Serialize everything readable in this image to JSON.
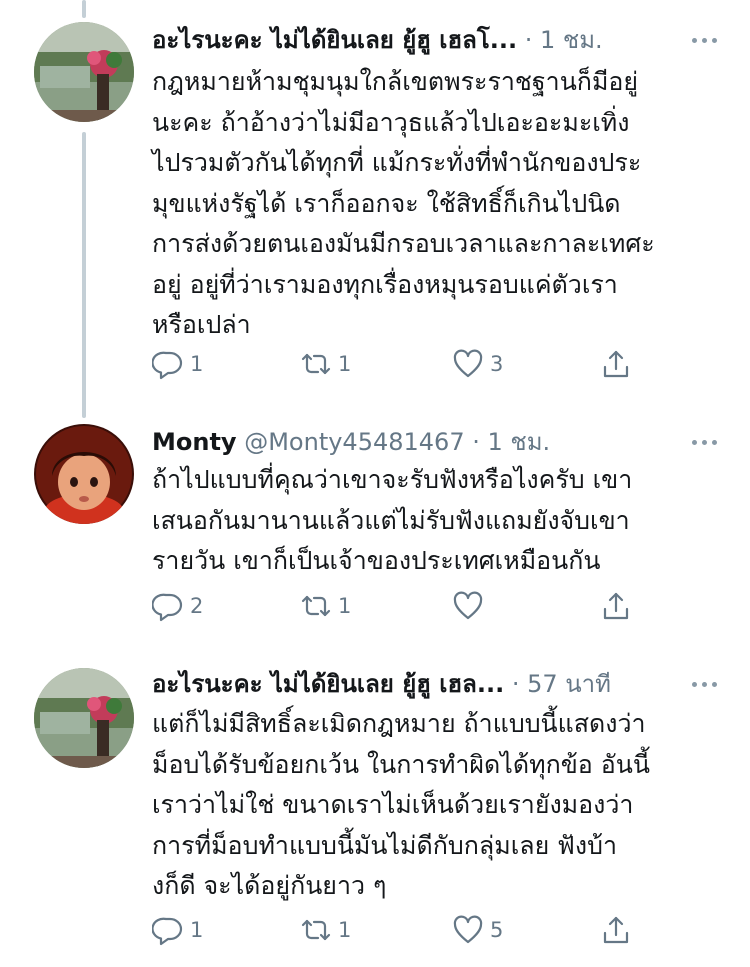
{
  "tweets": [
    {
      "name": "อะไรนะคะ ไม่ได้ยินเลย ยู้ฮู เฮลโ...",
      "handle": "",
      "dot": "·",
      "time": "1 ชม.",
      "lines": [
        "กฎหมายห้ามชุมนุมใกล้เขตพระราชฐานก็มีอยู่",
        "นะคะ ถ้าอ้างว่าไม่มีอาวุธแล้วไปเอะอะมะเทิ่ง",
        "ไปรวมตัวกันได้ทุกที่ แม้กระทั่งที่พำนักของประ",
        "มุขแห่งรัฐได้ เราก็ออกจะ ใช้สิทธิ์ก็เกินไปนิด",
        "การส่งด้วยตนเองมันมีกรอบเวลาและกาละเทศะ",
        "อยู่ อยู่ที่ว่าเรามองทุกเรื่องหมุนรอบแค่ตัวเรา",
        "หรือเปล่า"
      ],
      "replies": "1",
      "retweets": "1",
      "likes": "3"
    },
    {
      "name": "Monty",
      "handle": "@Monty45481467",
      "dot": "·",
      "time": "1 ชม.",
      "lines": [
        "ถ้าไปแบบที่คุณว่าเขาจะรับฟังหรือไงครับ  เขา",
        "เสนอกันมานานแล้วแต่ไม่รับฟังแถมยังจับเขา",
        "รายวัน เขาก็เป็นเจ้าของประเทศเหมือนกัน"
      ],
      "replies": "2",
      "retweets": "1",
      "likes": ""
    },
    {
      "name": "อะไรนะคะ ไม่ได้ยินเลย ยู้ฮู เฮล...",
      "handle": "",
      "dot": "·",
      "time": "57 นาที",
      "lines": [
        "แต่ก็ไม่มีสิทธิ์ละเมิดกฎหมาย ถ้าแบบนี้แสดงว่า",
        "ม็อบได้รับข้อยกเว้น ในการทำผิดได้ทุกข้อ อันนี้",
        "เราว่าไม่ใช่ ขนาดเราไม่เห็นด้วยเรายังมองว่า",
        "การที่ม็อบทำแบบนี้มันไม่ดีกับกลุ่มเลย ฟังบ้า",
        "งก็ดี จะได้อยู่กันยาว ๆ"
      ],
      "replies": "1",
      "retweets": "1",
      "likes": "5"
    }
  ],
  "icons": {
    "reply": "reply-icon",
    "retweet": "retweet-icon",
    "like": "heart-icon",
    "share": "share-icon",
    "more": "more-icon"
  },
  "colors": {
    "text": "#14171a",
    "secondary": "#657786",
    "thread_line": "#c4cfd6"
  }
}
